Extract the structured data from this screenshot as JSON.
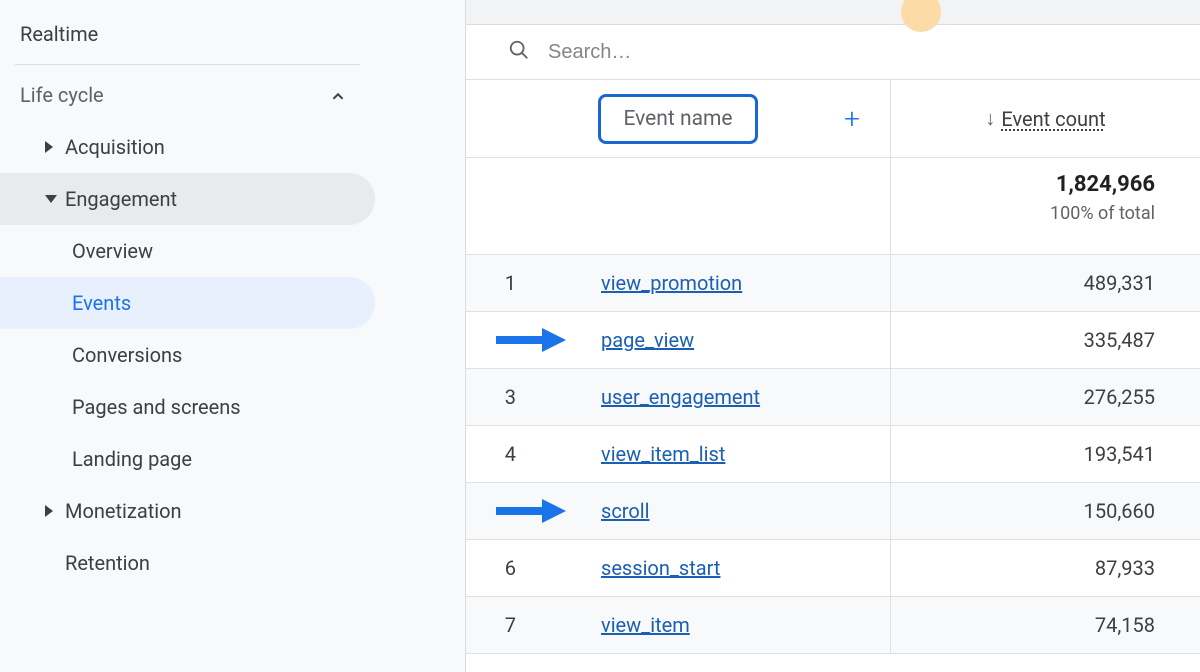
{
  "sidebar": {
    "realtime": "Realtime",
    "lifecycle_header": "Life cycle",
    "acquisition": "Acquisition",
    "engagement": "Engagement",
    "engagement_children": {
      "overview": "Overview",
      "events": "Events",
      "conversions": "Conversions",
      "pages_screens": "Pages and screens",
      "landing_page": "Landing page"
    },
    "monetization": "Monetization",
    "retention": "Retention"
  },
  "search": {
    "placeholder": "Search…"
  },
  "table": {
    "header_name": "Event name",
    "header_count": "Event count",
    "total_value": "1,824,966",
    "total_pct": "100% of total",
    "rows": [
      {
        "num": "1",
        "name": "view_promotion",
        "count": "489,331",
        "arrow": false
      },
      {
        "num": "",
        "name": "page_view",
        "count": "335,487",
        "arrow": true
      },
      {
        "num": "3",
        "name": "user_engagement",
        "count": "276,255",
        "arrow": false
      },
      {
        "num": "4",
        "name": "view_item_list",
        "count": "193,541",
        "arrow": false
      },
      {
        "num": "",
        "name": "scroll",
        "count": "150,660",
        "arrow": true
      },
      {
        "num": "6",
        "name": "session_start",
        "count": "87,933",
        "arrow": false
      },
      {
        "num": "7",
        "name": "view_item",
        "count": "74,158",
        "arrow": false
      }
    ]
  }
}
